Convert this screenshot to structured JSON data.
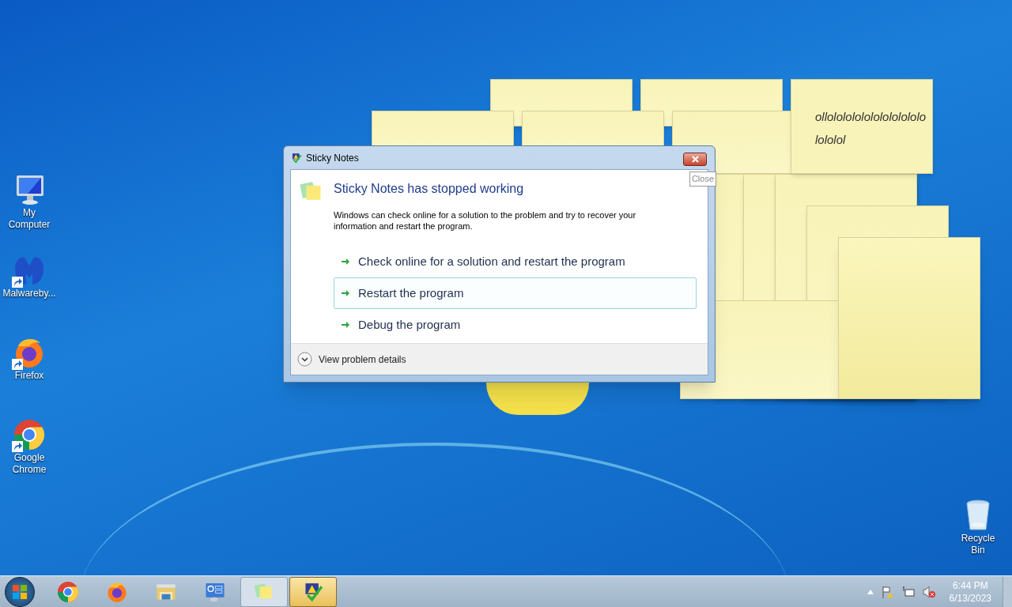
{
  "desktop_icons": [
    {
      "kind": "computer",
      "label": "My Computer",
      "shortcut": false
    },
    {
      "kind": "malware",
      "label": "Malwareby...",
      "shortcut": true
    },
    {
      "kind": "firefox",
      "label": "Firefox",
      "shortcut": true
    },
    {
      "kind": "chrome",
      "label": "Google Chrome",
      "shortcut": true
    },
    {
      "kind": "recycle",
      "label": "Recycle Bin",
      "shortcut": false
    }
  ],
  "sticky_note": {
    "lines": [
      "ollololololololololololo",
      "lololol"
    ]
  },
  "dialog": {
    "title": "Sticky Notes",
    "heading": "Sticky Notes has stopped working",
    "message": "Windows can check online for a solution to the problem and try to recover your information and restart the program.",
    "options": [
      {
        "label": "Check online for a solution and restart the program",
        "selected": false
      },
      {
        "label": "Restart the program",
        "selected": true
      },
      {
        "label": "Debug the program",
        "selected": false
      }
    ],
    "details": {
      "label": "View problem details",
      "expanded": false
    },
    "close_tooltip": "Close"
  },
  "taskbar": {
    "buttons": [
      {
        "kind": "chrome",
        "selected": false
      },
      {
        "kind": "firefox",
        "selected": false
      },
      {
        "kind": "explorer",
        "selected": false
      },
      {
        "kind": "control",
        "selected": false
      },
      {
        "kind": "notes",
        "selected": false
      },
      {
        "kind": "report",
        "selected": true
      }
    ],
    "time": "6:44 PM",
    "date": "6/13/2023"
  }
}
